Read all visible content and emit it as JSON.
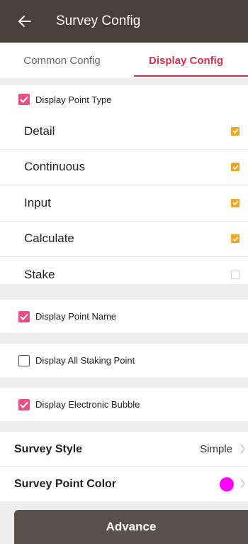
{
  "header": {
    "title": "Survey Config",
    "back_icon": "arrow-left-icon"
  },
  "tabs": [
    {
      "label": "Common Config",
      "active": false
    },
    {
      "label": "Display Config",
      "active": true
    }
  ],
  "display_point_type": {
    "label": "Display Point Type",
    "checked": true,
    "items": [
      {
        "label": "Detail",
        "checked": true
      },
      {
        "label": "Continuous",
        "checked": true
      },
      {
        "label": "Input",
        "checked": true
      },
      {
        "label": "Calculate",
        "checked": true
      },
      {
        "label": "Stake",
        "checked": false
      }
    ]
  },
  "display_point_name": {
    "label": "Display Point Name",
    "checked": true
  },
  "display_all_staking": {
    "label": "Display All Staking Point",
    "checked": false
  },
  "display_bubble": {
    "label": "Display Electronic Bubble",
    "checked": true
  },
  "survey_style": {
    "label": "Survey Style",
    "value": "Simple"
  },
  "survey_point_color": {
    "label": "Survey Point Color",
    "color": "#ff00ff"
  },
  "advance_button": {
    "label": "Advance"
  },
  "colors": {
    "accent": "#d9304f",
    "checkbox_pink": "#ee4f82",
    "checkbox_orange": "#f2a425",
    "header_bg": "#4a403b"
  }
}
